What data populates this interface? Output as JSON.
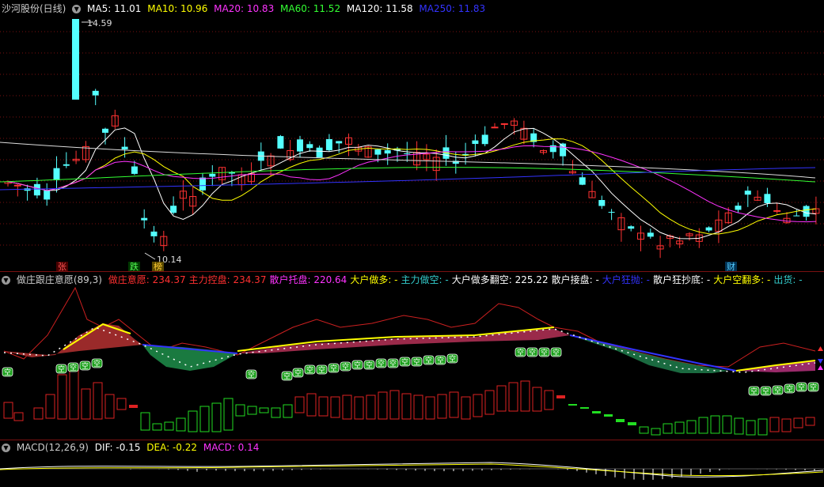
{
  "main": {
    "stock_title": "沙河股份(日线)",
    "ma_legend": [
      {
        "label": "MA5: 11.01",
        "color": "#ffffff"
      },
      {
        "label": "MA10: 10.96",
        "color": "#ffff00"
      },
      {
        "label": "MA20: 10.83",
        "color": "#ff33ff"
      },
      {
        "label": "MA60: 11.52",
        "color": "#33ff33"
      },
      {
        "label": "MA120: 11.58",
        "color": "#ffffff"
      },
      {
        "label": "MA250: 11.83",
        "color": "#3333ff"
      }
    ],
    "high_label": "14.59",
    "low_label": "10.14",
    "markers": {
      "zhang": "张",
      "die": "跌",
      "bang": "榜",
      "cai": "财"
    }
  },
  "indicator": {
    "title": "做庄跟庄意愿(89,3)",
    "items": [
      {
        "label": "做庄意愿:",
        "value": "234.37",
        "color": "#ff3030"
      },
      {
        "label": "主力控盘:",
        "value": "234.37",
        "color": "#ff3030"
      },
      {
        "label": "散户托盘:",
        "value": "220.64",
        "color": "#ff33ff"
      },
      {
        "label": "大户做多:",
        "value": "-",
        "color": "#ffff00"
      },
      {
        "label": "主力做空:",
        "value": "-",
        "color": "#33cccc"
      },
      {
        "label": "大户做多翻空:",
        "value": "225.22",
        "color": "#ffffff"
      },
      {
        "label": "散户接盘:",
        "value": "-",
        "color": "#ffffff"
      },
      {
        "label": "大户狂抛:",
        "value": "-",
        "color": "#3333ff"
      },
      {
        "label": "散户狂抄底:",
        "value": "-",
        "color": "#ffffff"
      },
      {
        "label": "大户空翻多:",
        "value": "-",
        "color": "#ffff00"
      },
      {
        "label": "出货:",
        "value": "-",
        "color": "#33cccc"
      }
    ],
    "badge_text": "空"
  },
  "macd": {
    "title": "MACD(12,26,9)",
    "dif": "DIF: -0.15",
    "dea": "DEA: -0.22",
    "macd": "MACD: 0.14"
  },
  "colors": {
    "up": "#ff3232",
    "down": "#54ffff",
    "grid": "#7a1010",
    "bg": "#000000"
  }
}
